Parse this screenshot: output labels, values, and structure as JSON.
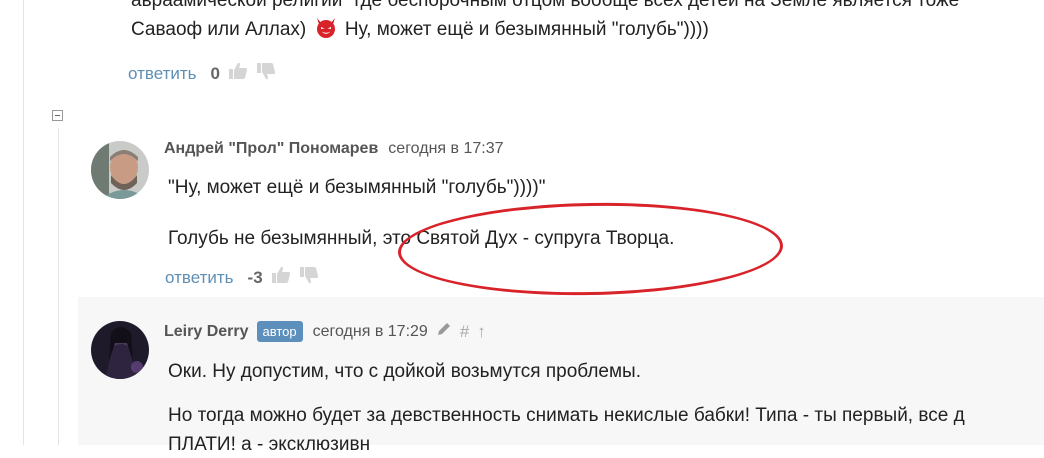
{
  "colors": {
    "link": "#5f8fb5",
    "badge": "#5d8fbd",
    "annotation": "#d9232a",
    "nested_bg": "#f7f7f7"
  },
  "top_comment": {
    "cut_line": "авраамической религии \"где беспорочным отцом вообще всех детей на Земле является тоже",
    "line2_start": "Саваоф или Аллах)",
    "line2_end": "Ну, может ещё и безымянный \"голубь\"))))",
    "emoji": "devil-emoji",
    "reply": "ответить",
    "score": "0"
  },
  "comment_prol": {
    "author": "Андрей \"Прол\" Пономарев",
    "time": "сегодня в 17:37",
    "quote": "\"Ну, может ещё и безымянный \"голубь\"))))\"",
    "text": "Голубь не безымянный, это Святой Дух - супруга Творца.",
    "reply": "ответить",
    "score": "-3"
  },
  "comment_leiry": {
    "author": "Leiry Derry",
    "badge": "автор",
    "time": "сегодня в 17:29",
    "hash": "#",
    "arrow": "↑",
    "p1": "Оки. Ну допустим, что с дойкой возьмутся проблемы.",
    "p2": "Но тогда можно будет за девственность снимать некислые бабки! Типа - ты первый, все д",
    "p3": "ПЛАТИ! а - эксклюзивн"
  },
  "icons": {
    "like": "thumbs-up-icon",
    "dislike": "thumbs-down-icon",
    "edit": "pencil-icon",
    "collapse": "minus-box-icon"
  }
}
